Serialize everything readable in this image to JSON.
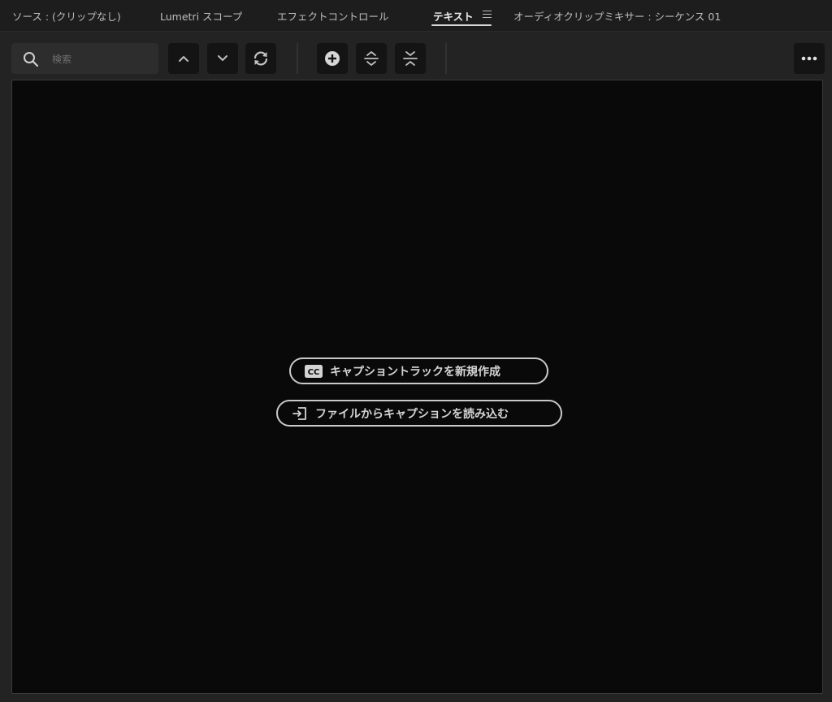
{
  "tabs": [
    {
      "label": "ソース : (クリップなし)"
    },
    {
      "label": "Lumetri スコープ"
    },
    {
      "label": "エフェクトコントロール"
    },
    {
      "label": "テキスト"
    },
    {
      "label": "オーディオクリップミキサー : シーケンス 01"
    }
  ],
  "active_tab": "テキスト",
  "search": {
    "placeholder": "検索",
    "value": ""
  },
  "toolbar": {
    "icons": [
      "chevron-up-icon",
      "chevron-down-icon",
      "refresh-icon",
      "add-circle-icon",
      "split-icon",
      "merge-icon",
      "more-icon"
    ]
  },
  "empty_state": {
    "create_caption_track_label": "キャプショントラックを新規作成",
    "import_captions_label": "ファイルからキャプションを読み込む",
    "cc_badge": "CC"
  },
  "colors": {
    "background": "#232323",
    "panel": "#090909",
    "button": "#141414",
    "text": "#d4d4d4"
  }
}
